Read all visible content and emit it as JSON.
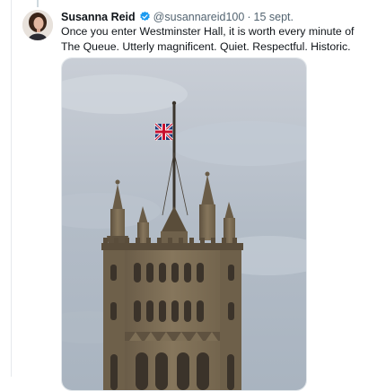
{
  "tweet": {
    "author_name": "Susanna Reid",
    "handle": "@susannareid100",
    "separator": "·",
    "date": "15 sept.",
    "text": "Once you enter Westminster Hall, it is worth every minute of The Queue. Utterly magnificent. Quiet. Respectful. Historic.",
    "verified": true
  },
  "icons": {
    "verified": "verified-badge-icon",
    "avatar": "profile-avatar",
    "photo": "elizabeth-tower-with-union-flag-photo"
  },
  "colors": {
    "name": "#0f1419",
    "secondary_text": "#536471",
    "verified_badge": "#1d9bf0",
    "sky": "#b9c2cc",
    "stone": "#7a6a52"
  }
}
